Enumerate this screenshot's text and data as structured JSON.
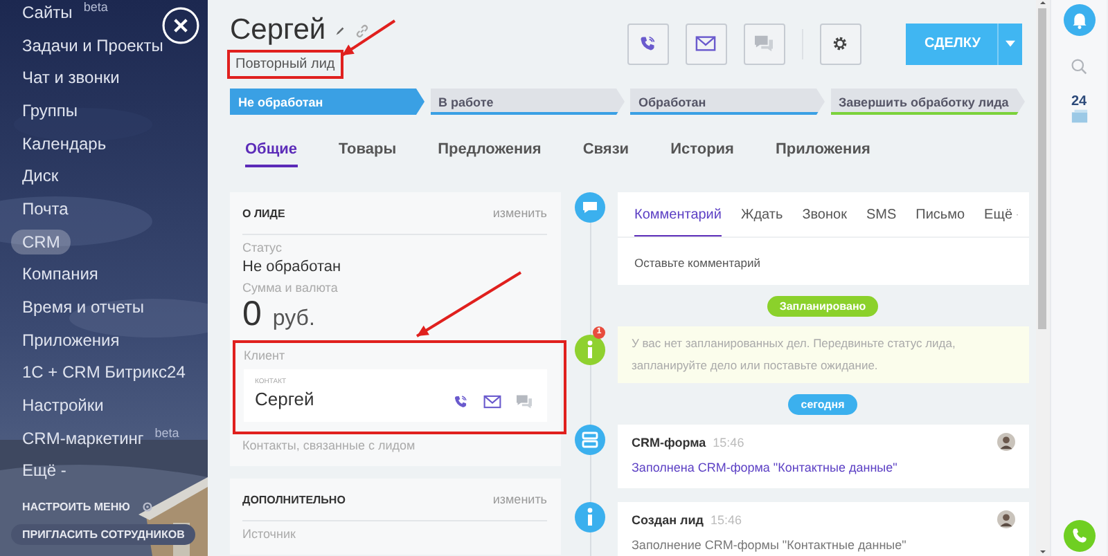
{
  "sidebar": {
    "items": [
      {
        "label": "Сайты",
        "badge": "beta",
        "selected": false
      },
      {
        "label": "Задачи и Проекты",
        "selected": false
      },
      {
        "label": "Чат и звонки",
        "selected": false
      },
      {
        "label": "Группы",
        "selected": false
      },
      {
        "label": "Календарь",
        "selected": false
      },
      {
        "label": "Диск",
        "selected": false
      },
      {
        "label": "Почта",
        "selected": false
      },
      {
        "label": "CRM",
        "selected": true
      },
      {
        "label": "Компания",
        "selected": false
      },
      {
        "label": "Время и отчеты",
        "selected": false
      },
      {
        "label": "Приложения",
        "selected": false
      },
      {
        "label": "1С + CRM Битрикс24",
        "selected": false
      },
      {
        "label": "Настройки",
        "selected": false
      },
      {
        "label": "CRM-маркетинг",
        "badge": "beta",
        "selected": false
      },
      {
        "label": "Ещё -",
        "selected": false
      }
    ],
    "settings": "НАСТРОИТЬ МЕНЮ",
    "invite": "ПРИГЛАСИТЬ СОТРУДНИКОВ"
  },
  "header": {
    "title": "Сергей",
    "tag": {
      "label": "Повторный лид",
      "highlighted": true
    },
    "convert_button": "СДЕЛКУ"
  },
  "stages": [
    {
      "label": "Не обработан",
      "selected": true,
      "color": "#3aa0e4"
    },
    {
      "label": "В работе",
      "selected": false,
      "color": "#3aa0e4"
    },
    {
      "label": "Обработан",
      "selected": false,
      "color": "#3aa0e4"
    },
    {
      "label": "Завершить обработку лида",
      "selected": false,
      "color": "#7bd23b"
    }
  ],
  "tabs": [
    {
      "label": "Общие",
      "selected": true
    },
    {
      "label": "Товары",
      "selected": false
    },
    {
      "label": "Предложения",
      "selected": false
    },
    {
      "label": "Связи",
      "selected": false
    },
    {
      "label": "История",
      "selected": false
    },
    {
      "label": "Приложения",
      "selected": false
    }
  ],
  "lead_card": {
    "title": "О ЛИДЕ",
    "action": "изменить",
    "status_label": "Статус",
    "status": "Не обработан",
    "amount_label": "Сумма и валюта",
    "amount": "0",
    "currency": "руб.",
    "client": {
      "label": "Клиент",
      "kind_label": "КОНТАКТ",
      "name": "Сергей",
      "highlighted": true
    },
    "note": "Контакты, связанные с лидом"
  },
  "extra_card": {
    "title": "ДОПОЛНИТЕЛЬНО",
    "action": "изменить",
    "field_label": "Источник"
  },
  "timeline": {
    "composer_tabs": [
      {
        "label": "Комментарий",
        "selected": true
      },
      {
        "label": "Ждать",
        "selected": false
      },
      {
        "label": "Звонок",
        "selected": false
      },
      {
        "label": "SMS",
        "selected": false
      },
      {
        "label": "Письмо",
        "selected": false
      }
    ],
    "more": "Ещё",
    "placeholder": "Оставьте комментарий",
    "planned": "Запланировано",
    "notice_badge": "1",
    "notice": "У вас нет запланированных дел. Передвиньте статус лида, запланируйте дело или поставьте ожидание.",
    "today": "сегодня",
    "events": [
      {
        "kind": "form",
        "title": "CRM-форма",
        "time": "15:46",
        "text": "Заполнена CRM-форма \"Контактные данные\""
      },
      {
        "kind": "info",
        "title": "Создан лид",
        "time": "15:46",
        "text": "Заполнение CRM-формы \"Контактные данные\""
      }
    ]
  },
  "rightbar": {
    "app_label": "24"
  }
}
